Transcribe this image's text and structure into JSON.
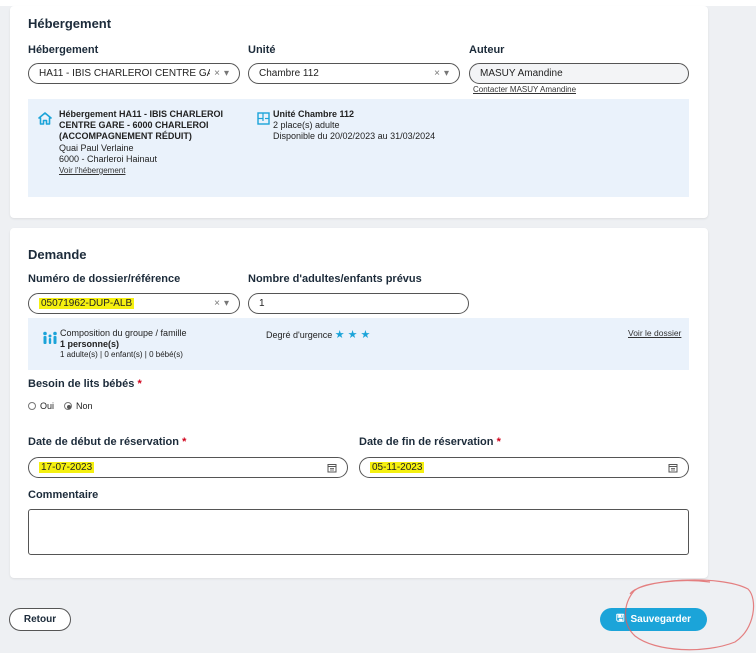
{
  "accommodation": {
    "section_title": "Hébergement",
    "hebergement_label": "Hébergement",
    "hebergement_value": "HA11 - IBIS CHARLEROI CENTRE GA...",
    "unite_label": "Unité",
    "unite_value": "Chambre 112",
    "auteur_label": "Auteur",
    "auteur_value": "MASUY Amandine",
    "contact_link": "Contacter MASUY Amandine",
    "info": {
      "title_line1": "Hébergement HA11 - IBIS CHARLEROI",
      "title_line2": "CENTRE GARE - 6000 CHARLEROI",
      "title_line3": "(ACCOMPAGNEMENT RÉDUIT)",
      "address1": "Quai Paul Verlaine",
      "address2": "6000 - Charleroi Hainaut",
      "view_link": "Voir l'hébergement",
      "unit_title": "Unité Chambre 112",
      "unit_places": "2 place(s) adulte",
      "unit_availability": "Disponible du 20/02/2023 au 31/03/2024"
    }
  },
  "request": {
    "section_title": "Demande",
    "dossier_label": "Numéro de dossier/référence",
    "dossier_value": "05071962-DUP-ALB",
    "count_label": "Nombre d'adultes/enfants prévus",
    "count_value": "1",
    "group": {
      "title": "Composition du groupe / famille",
      "persons": "1 personne(s)",
      "detail": "1 adulte(s) | 0 enfant(s) | 0 bébé(s)",
      "urgency_label": "Degré d'urgence",
      "urgency_stars": 3,
      "view_link": "Voir le dossier"
    },
    "cribs_label": "Besoin de lits bébés",
    "cribs_options": [
      "Oui",
      "Non"
    ],
    "cribs_selected": "Non",
    "start_label": "Date de début de réservation",
    "start_value": "17-07-2023",
    "end_label": "Date de fin de réservation",
    "end_value": "05-11-2023",
    "comment_label": "Commentaire",
    "comment_value": ""
  },
  "footer": {
    "back_label": "Retour",
    "save_label": "Sauvegarder"
  },
  "colors": {
    "accent": "#1ba4d9",
    "highlight": "#f5f010",
    "annotation": "#e05a5a"
  }
}
